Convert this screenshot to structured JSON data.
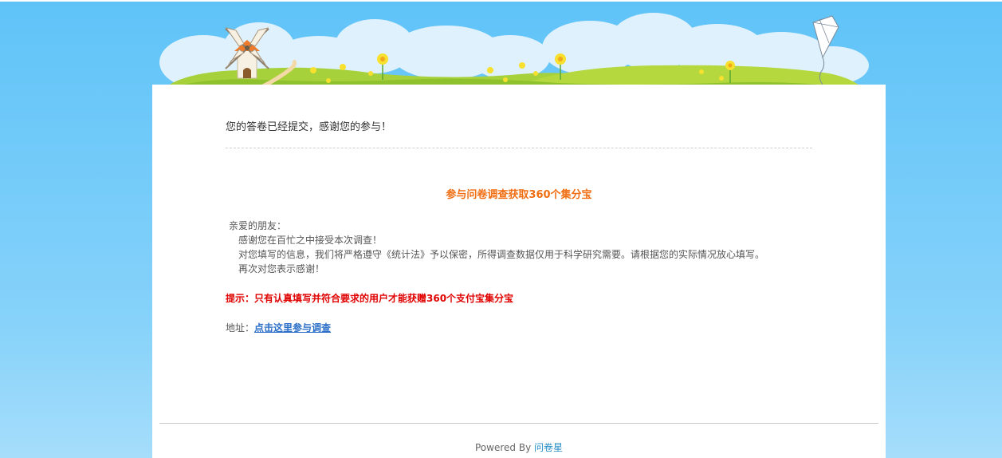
{
  "message": {
    "submitted_text": "您的答卷已经提交，感谢您的参与！"
  },
  "promo": {
    "title": "参与问卷调查获取360个集分宝",
    "greeting": "亲爱的朋友：",
    "lines": [
      "感谢您在百忙之中接受本次调查！",
      "对您填写的信息，我们将严格遵守《统计法》予以保密，所得调查数据仅用于科学研究需要。请根据您的实际情况放心填写。",
      "再次对您表示感谢！"
    ],
    "tip": "提示：只有认真填写并符合要求的用户才能获赠360个支付宝集分宝",
    "address_label": "地址：",
    "address_link": "点击这里参与调查"
  },
  "footer": {
    "powered_by": "Powered By ",
    "brand": "问卷星"
  },
  "colors": {
    "sky": "#5fc3f8",
    "promo_title": "#f06d12",
    "tip": "#e00000",
    "link": "#2a6ec7"
  },
  "icons": [
    "windmill-icon",
    "kite-icon",
    "flower-icon",
    "cloud-icon"
  ]
}
